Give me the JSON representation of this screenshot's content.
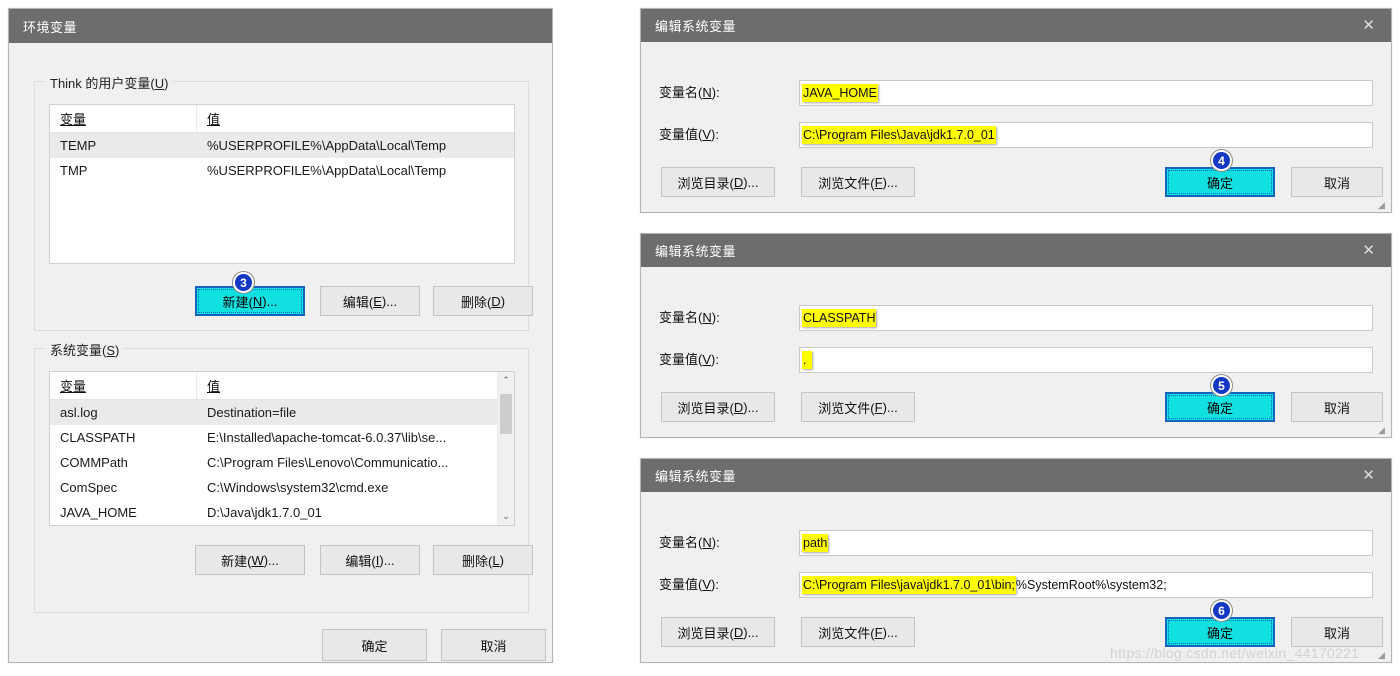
{
  "env_dialog": {
    "title": "环境变量",
    "user_group": {
      "legend_prefix": "Think 的用户变量(",
      "legend_accel": "U",
      "legend_suffix": ")",
      "columns": [
        "变量",
        "值"
      ],
      "rows": [
        {
          "name": "TEMP",
          "value": "%USERPROFILE%\\AppData\\Local\\Temp",
          "selected": true
        },
        {
          "name": "TMP",
          "value": "%USERPROFILE%\\AppData\\Local\\Temp",
          "selected": false
        }
      ],
      "buttons": {
        "new": {
          "pre": "新建(",
          "accel": "N",
          "post": ")...",
          "highlighted": true
        },
        "edit": {
          "pre": "编辑(",
          "accel": "E",
          "post": ")...",
          "highlighted": false
        },
        "delete": {
          "pre": "删除(",
          "accel": "D",
          "post": ")",
          "highlighted": false
        }
      },
      "step_badge": "3"
    },
    "system_group": {
      "legend_prefix": "系统变量(",
      "legend_accel": "S",
      "legend_suffix": ")",
      "columns": [
        "变量",
        "值"
      ],
      "rows": [
        {
          "name": "asl.log",
          "value": "Destination=file",
          "selected": true
        },
        {
          "name": "CLASSPATH",
          "value": "E:\\Installed\\apache-tomcat-6.0.37\\lib\\se...",
          "selected": false
        },
        {
          "name": "COMMPath",
          "value": "C:\\Program Files\\Lenovo\\Communicatio...",
          "selected": false
        },
        {
          "name": "ComSpec",
          "value": "C:\\Windows\\system32\\cmd.exe",
          "selected": false
        },
        {
          "name": "JAVA_HOME",
          "value": "D:\\Java\\jdk1.7.0_01",
          "selected": false
        }
      ],
      "scroll_up_icon": "⌃",
      "scroll_down_icon": "⌄",
      "buttons": {
        "new": {
          "pre": "新建(",
          "accel": "W",
          "post": ")..."
        },
        "edit": {
          "pre": "编辑(",
          "accel": "I",
          "post": ")..."
        },
        "delete": {
          "pre": "删除(",
          "accel": "L",
          "post": ")"
        }
      }
    },
    "footer": {
      "ok": "确定",
      "cancel": "取消"
    }
  },
  "edit_dialogs": [
    {
      "title": "编辑系统变量",
      "close_icon": "✕",
      "name_label_pre": "变量名(",
      "name_label_accel": "N",
      "name_label_post": "):",
      "value_label_pre": "变量值(",
      "value_label_accel": "V",
      "value_label_post": "):",
      "name_value": "JAVA_HOME",
      "value_value": "C:\\Program Files\\Java\\jdk1.7.0_01",
      "browse_dir": {
        "pre": "浏览目录(",
        "accel": "D",
        "post": ")..."
      },
      "browse_file": {
        "pre": "浏览文件(",
        "accel": "F",
        "post": ")..."
      },
      "ok": "确定",
      "cancel": "取消",
      "step_badge": "4"
    },
    {
      "title": "编辑系统变量",
      "close_icon": "✕",
      "name_label_pre": "变量名(",
      "name_label_accel": "N",
      "name_label_post": "):",
      "value_label_pre": "变量值(",
      "value_label_accel": "V",
      "value_label_post": "):",
      "name_value": "CLASSPATH",
      "value_value": ".",
      "browse_dir": {
        "pre": "浏览目录(",
        "accel": "D",
        "post": ")..."
      },
      "browse_file": {
        "pre": "浏览文件(",
        "accel": "F",
        "post": ")..."
      },
      "ok": "确定",
      "cancel": "取消",
      "step_badge": "5"
    },
    {
      "title": "编辑系统变量",
      "close_icon": "✕",
      "name_label_pre": "变量名(",
      "name_label_accel": "N",
      "name_label_post": "):",
      "value_label_pre": "变量值(",
      "value_label_accel": "V",
      "value_label_post": "):",
      "name_value": "path",
      "value_value": "C:\\Program Files\\java\\jdk1.7.0_01\\bin;",
      "value_value_tail": "%SystemRoot%\\system32;",
      "browse_dir": {
        "pre": "浏览目录(",
        "accel": "D",
        "post": ")..."
      },
      "browse_file": {
        "pre": "浏览文件(",
        "accel": "F",
        "post": ")..."
      },
      "ok": "确定",
      "cancel": "取消",
      "step_badge": "6"
    }
  ],
  "watermark": "https://blog.csdn.net/weixin_44170221",
  "colors": {
    "titlebar": "#6d6d6d",
    "highlight_button": "#11e0e0",
    "highlight_border": "#1565c0",
    "badge": "#1437c4",
    "field_highlight": "#ffff00",
    "dialog_bg": "#f0f0f0"
  }
}
